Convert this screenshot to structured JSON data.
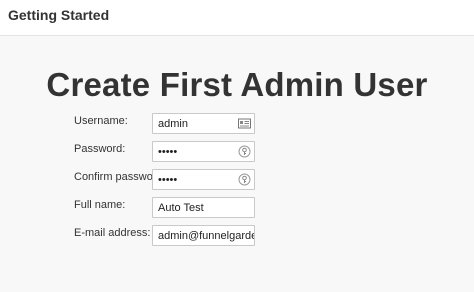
{
  "header": {
    "title": "Getting Started"
  },
  "page": {
    "heading": "Create First Admin User"
  },
  "form": {
    "username": {
      "label": "Username:",
      "value": "admin",
      "icon": "contact-card-icon"
    },
    "password": {
      "label": "Password:",
      "value": "•••••",
      "icon": "key-icon"
    },
    "confirm_password": {
      "label": "Confirm password:",
      "value": "•••••",
      "icon": "key-icon"
    },
    "full_name": {
      "label": "Full name:",
      "value": "Auto Test"
    },
    "email": {
      "label": "E-mail address:",
      "value": "admin@funnelgarden.c"
    }
  }
}
